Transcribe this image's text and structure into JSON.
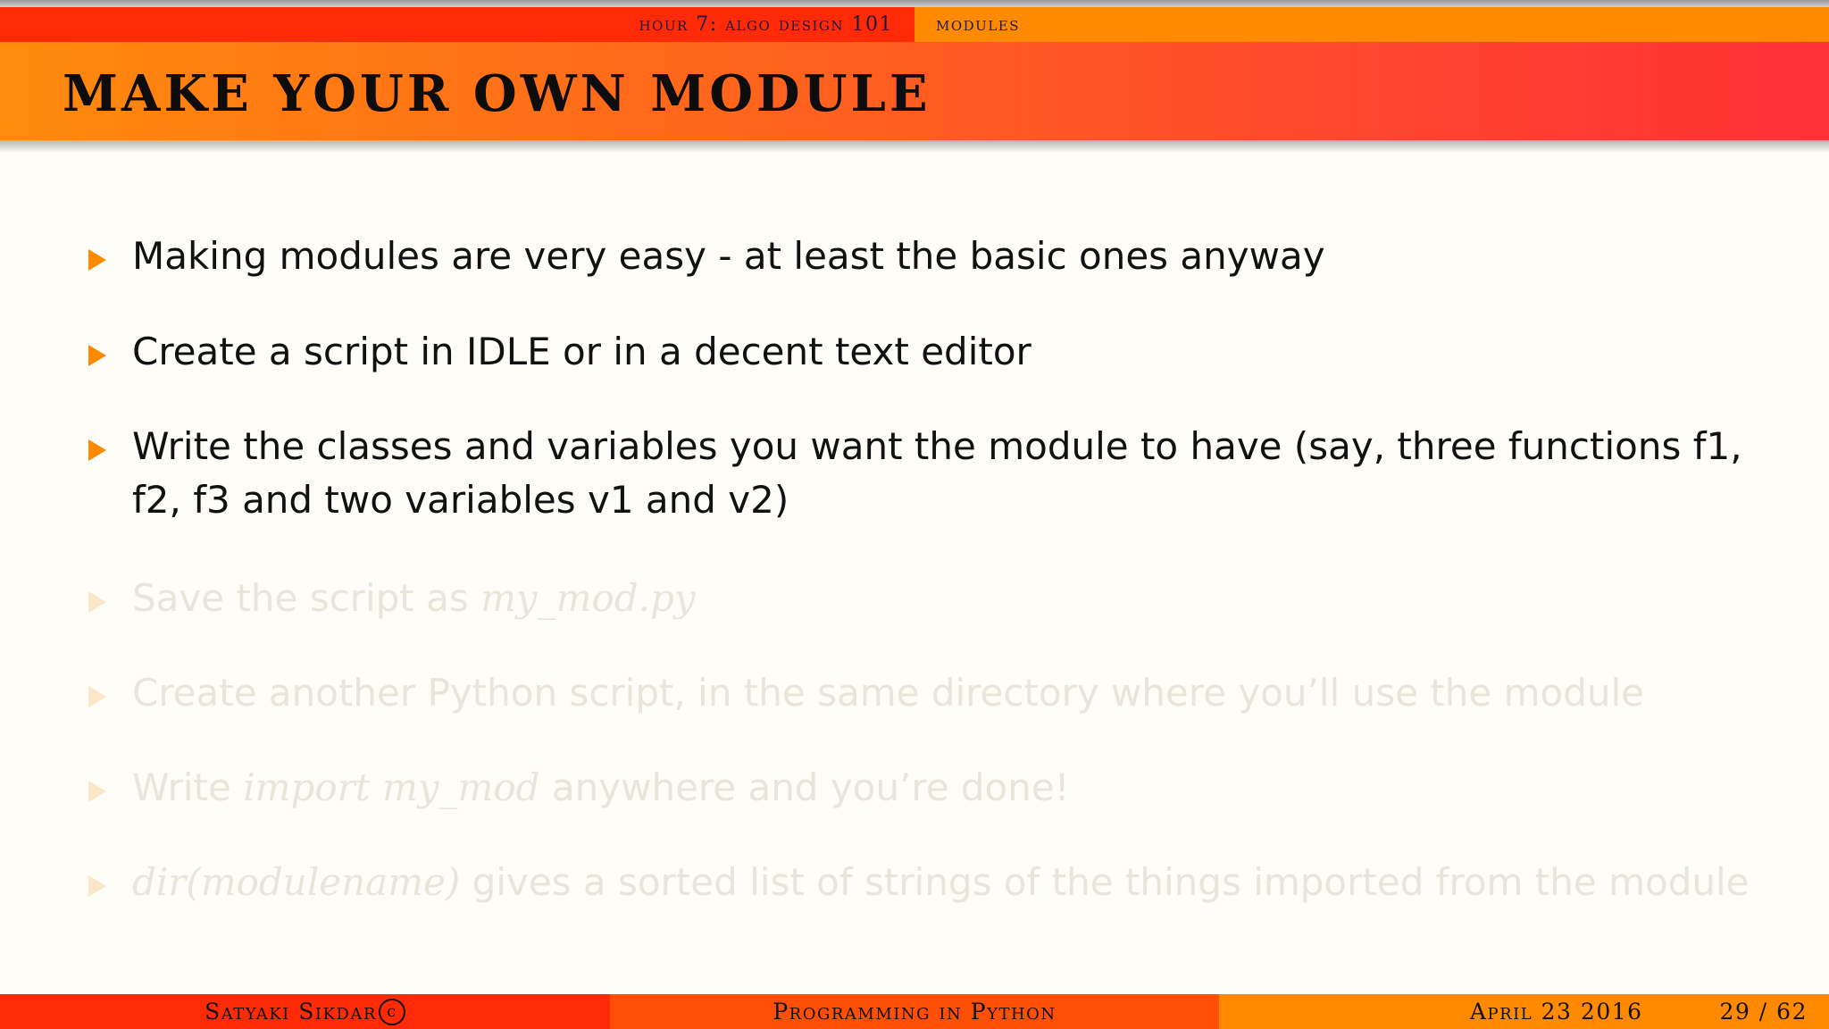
{
  "navbar": {
    "section": "hour 7: algo design 101",
    "subsection": "modules"
  },
  "frame": {
    "title": "Make your own module"
  },
  "bullets": {
    "b1": "Making modules are very easy - at least the basic ones anyway",
    "b2": "Create a script in IDLE or in a decent text editor",
    "b3": "Write the classes and variables you want the module to have (say, three functions f1, f2, f3 and two variables v1 and v2)",
    "b4_text": "Save the script as ",
    "b4_code": "my_mod.py",
    "b5": "Create another Python script, in the same directory where you’ll use the module",
    "b6_pre": "Write ",
    "b6_code": "import my_mod",
    "b6_post": " anywhere and you’re done!",
    "b7_code": "dir(modulename)",
    "b7_text": " gives a sorted list of strings of the things imported from the module"
  },
  "footer": {
    "author": "Satyaki Sikdar",
    "copyright_symbol": "c",
    "talk_title": "Programming in Python",
    "date": "April 23 2016",
    "page": "29 / 62"
  },
  "colors": {
    "accent_orange": "#ff8a00",
    "accent_red": "#ff2a07",
    "title_gradient_start": "#ff8b0c",
    "title_gradient_end": "#ff3036",
    "background": "#fdfcf6",
    "dimmed_text": "#e9e5db"
  },
  "icons": {
    "bullet": "triangle-right-icon"
  }
}
